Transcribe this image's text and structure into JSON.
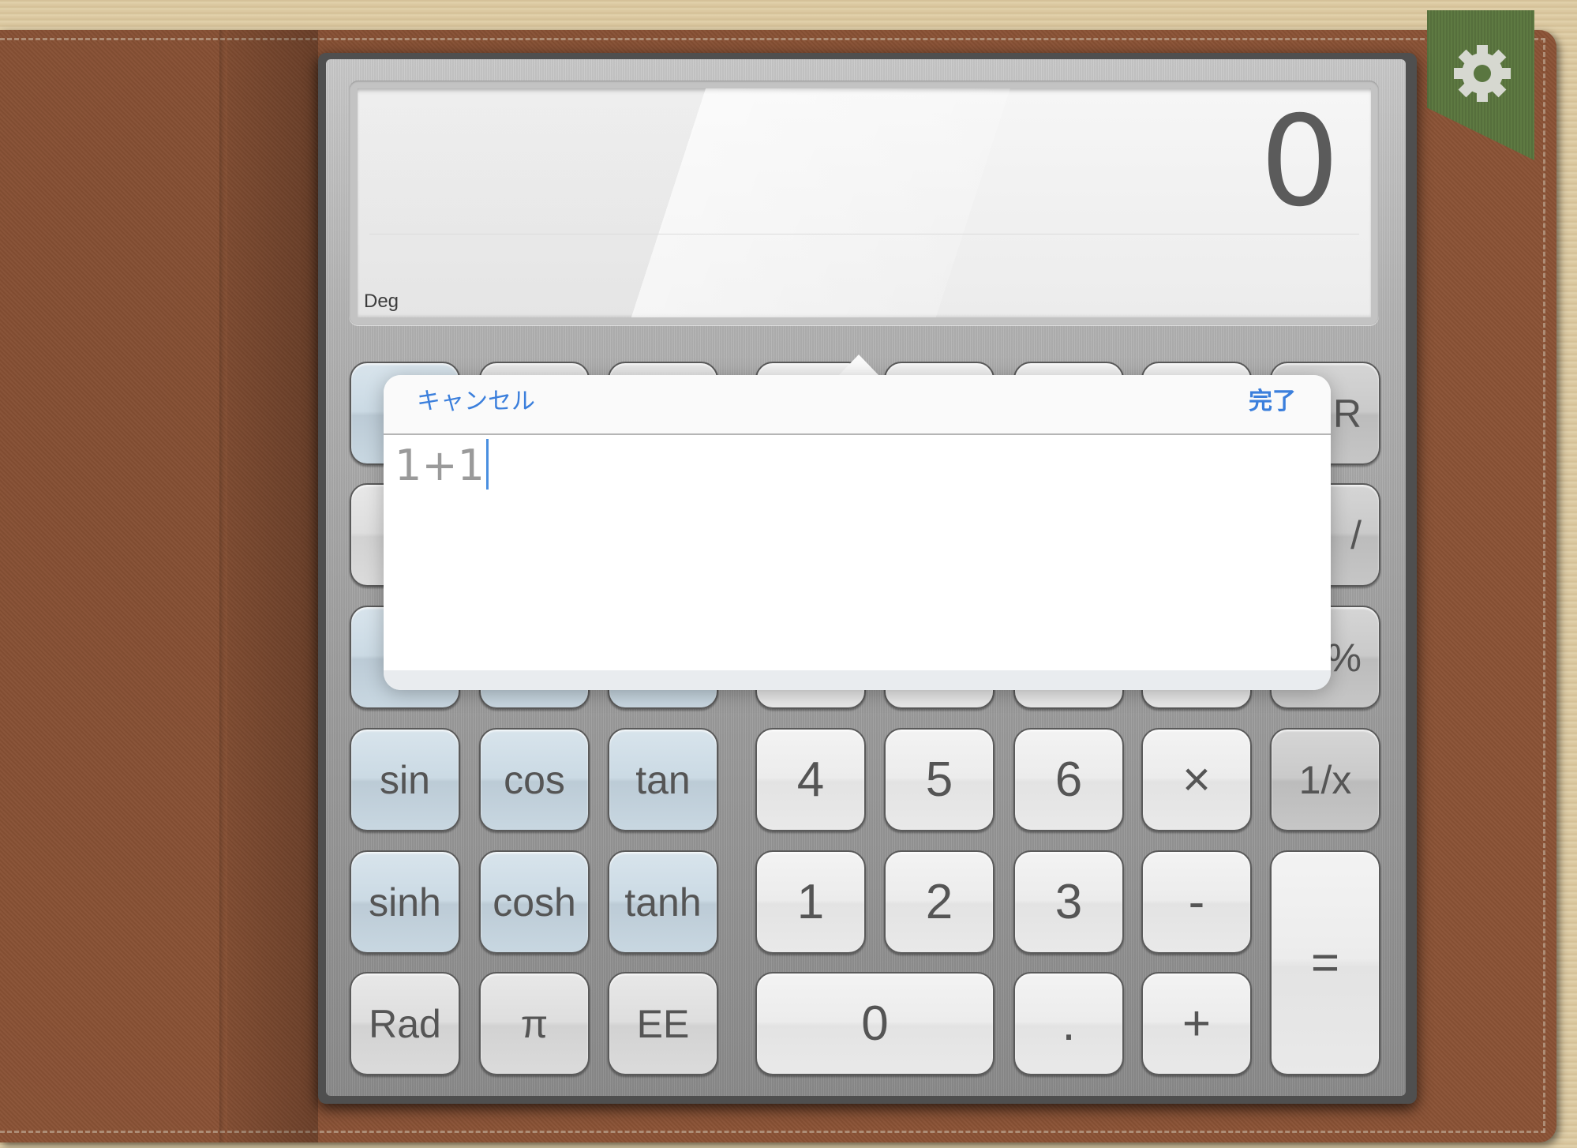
{
  "settings_tab": {
    "icon": "gear-icon"
  },
  "display": {
    "value": "0",
    "angle_mode": "Deg"
  },
  "keypad": {
    "rows": [
      [
        {
          "label": "",
          "style": "blue"
        },
        {
          "label": "",
          "style": "gray"
        },
        {
          "label": "",
          "style": "gray"
        },
        {
          "label": "",
          "style": "white"
        },
        {
          "label": "",
          "style": "white"
        },
        {
          "label": "",
          "style": "white"
        },
        {
          "label": "",
          "style": "white"
        },
        {
          "label": "R",
          "style": "dark"
        }
      ],
      [
        {
          "label": "",
          "style": "gray"
        },
        {
          "label": "",
          "style": "gray"
        },
        {
          "label": "",
          "style": "gray"
        },
        {
          "label": "",
          "style": "white"
        },
        {
          "label": "",
          "style": "white"
        },
        {
          "label": "",
          "style": "white"
        },
        {
          "label": "",
          "style": "white"
        },
        {
          "label": "/",
          "style": "dark"
        }
      ],
      [
        {
          "label": "",
          "style": "blue"
        },
        {
          "label": "",
          "style": "blue"
        },
        {
          "label": "",
          "style": "blue"
        },
        {
          "label": "",
          "style": "white"
        },
        {
          "label": "",
          "style": "white"
        },
        {
          "label": "",
          "style": "white"
        },
        {
          "label": "",
          "style": "white"
        },
        {
          "label": "%",
          "style": "dark"
        }
      ],
      [
        {
          "label": "sin",
          "style": "blue"
        },
        {
          "label": "cos",
          "style": "blue"
        },
        {
          "label": "tan",
          "style": "blue"
        },
        {
          "label": "4",
          "style": "white"
        },
        {
          "label": "5",
          "style": "white"
        },
        {
          "label": "6",
          "style": "white"
        },
        {
          "label": "×",
          "style": "white"
        },
        {
          "label": "1/x",
          "style": "dark"
        }
      ],
      [
        {
          "label": "sinh",
          "style": "blue"
        },
        {
          "label": "cosh",
          "style": "blue"
        },
        {
          "label": "tanh",
          "style": "blue"
        },
        {
          "label": "1",
          "style": "white"
        },
        {
          "label": "2",
          "style": "white"
        },
        {
          "label": "3",
          "style": "white"
        },
        {
          "label": "-",
          "style": "white"
        },
        {
          "label": "=",
          "style": "white"
        }
      ],
      [
        {
          "label": "Rad",
          "style": "gray"
        },
        {
          "label": "π",
          "style": "gray"
        },
        {
          "label": "EE",
          "style": "gray"
        },
        {
          "label": "0",
          "style": "white"
        },
        {
          "label": ".",
          "style": "white"
        },
        {
          "label": "+",
          "style": "white"
        }
      ]
    ]
  },
  "expression_popover": {
    "cancel_label": "キャンセル",
    "done_label": "完了",
    "input_value": "1+1"
  }
}
